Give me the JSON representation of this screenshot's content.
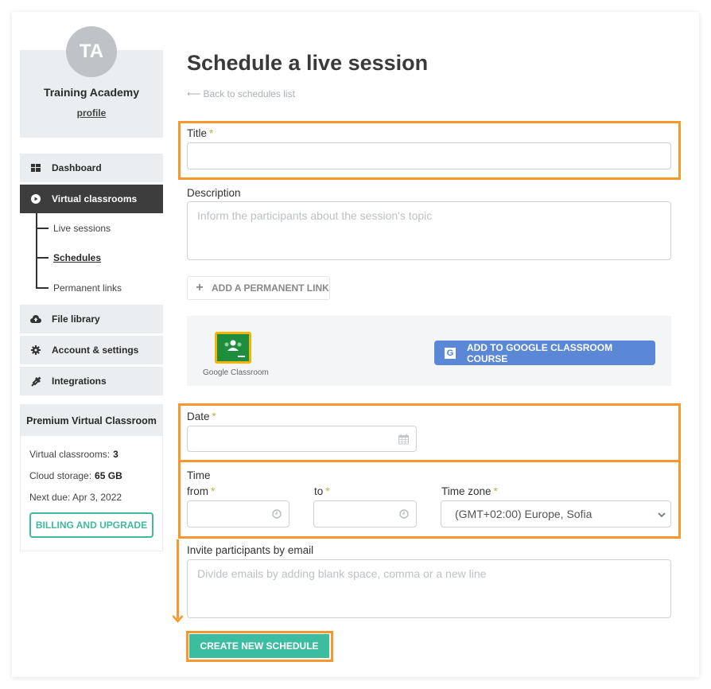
{
  "sidebar": {
    "avatar_initials": "TA",
    "profile_name": "Training Academy",
    "profile_link": "profile",
    "nav": [
      {
        "label": "Dashboard",
        "icon": "dashboard-grid-icon"
      },
      {
        "label": "Virtual classrooms",
        "icon": "play-circle-icon",
        "active": true
      },
      {
        "label": "File library",
        "icon": "cloud-upload-icon"
      },
      {
        "label": "Account & settings",
        "icon": "gear-icon"
      },
      {
        "label": "Integrations",
        "icon": "plug-icon"
      }
    ],
    "subnav": [
      {
        "label": "Live sessions"
      },
      {
        "label": "Schedules",
        "current": true
      },
      {
        "label": "Permanent links"
      }
    ],
    "plan": {
      "title": "Premium Virtual Classroom",
      "classrooms_label": "Virtual classrooms:",
      "classrooms_value": "3",
      "storage_label": "Cloud storage:",
      "storage_value": "65 GB",
      "next_due": "Next due: Apr 3, 2022",
      "billing_button": "BILLING AND UPGRADE"
    }
  },
  "main": {
    "title": "Schedule a live session",
    "back_link": "⟵ Back to schedules list",
    "fields": {
      "title_label": "Title",
      "title_value": "",
      "description_label": "Description",
      "description_placeholder": "Inform the participants about the session's topic",
      "add_permanent_link": "ADD A PERMANENT LINK",
      "google_classroom_label": "Google Classroom",
      "google_classroom_button": "ADD TO GOOGLE CLASSROOM COURSE",
      "date_label": "Date",
      "date_value": "",
      "time_label": "Time",
      "from_label": "from",
      "to_label": "to",
      "timezone_label": "Time zone",
      "timezone_value": "(GMT+02:00) Europe, Sofia",
      "invite_label": "Invite participants by email",
      "invite_placeholder": "Divide emails by adding blank space, comma or a new line",
      "required_mark": "*"
    },
    "create_button": "CREATE NEW SCHEDULE"
  },
  "colors": {
    "highlight": "#f7982e",
    "primary_green": "#3dbda0",
    "google_blue": "#5a87d6",
    "active_nav": "#3d3d3d"
  }
}
